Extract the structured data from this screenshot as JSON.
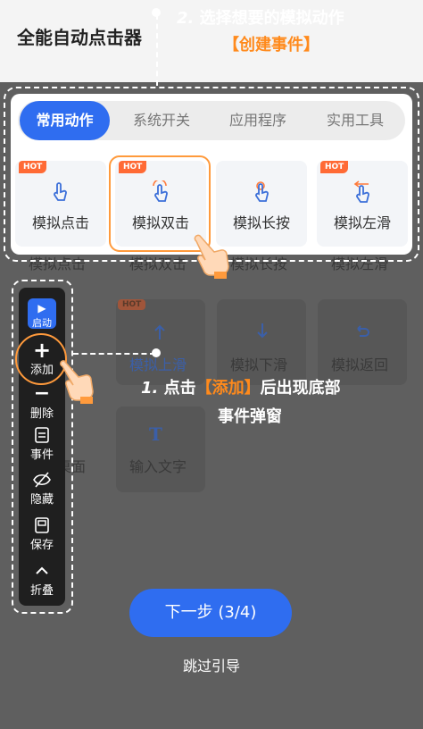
{
  "app": {
    "title": "全能自动点击器"
  },
  "guide": {
    "step2_num": "2.",
    "step2_text": "选择想要的模拟动作",
    "step2_sub": "【创建事件】",
    "step1_num": "1.",
    "step1_pre": "点击",
    "step1_highlight": "【添加】",
    "step1_post": "后出现底部",
    "step1_line2": "事件弹窗",
    "accent_color": "#ff8a1c"
  },
  "tabs": [
    {
      "label": "常用动作",
      "active": true
    },
    {
      "label": "系统开关",
      "active": false
    },
    {
      "label": "应用程序",
      "active": false
    },
    {
      "label": "实用工具",
      "active": false
    }
  ],
  "actions": [
    {
      "label": "模拟点击",
      "badge": "HOT",
      "icon": "tap-icon"
    },
    {
      "label": "模拟双击",
      "badge": "HOT",
      "icon": "double-tap-icon"
    },
    {
      "label": "模拟长按",
      "badge": "",
      "icon": "long-press-icon"
    },
    {
      "label": "模拟左滑",
      "badge": "HOT",
      "icon": "swipe-left-icon"
    }
  ],
  "background_actions": {
    "row1": [
      "模拟点击",
      "模拟双击",
      "模拟长按",
      "模拟左滑"
    ],
    "row2": [
      "模拟上滑",
      "模拟下滑",
      "模拟返回"
    ],
    "row2_badge": "HOT",
    "row3": [
      "返回桌面",
      "输入文字"
    ]
  },
  "toolbar": {
    "start": "启动",
    "add": "添加",
    "delete": "删除",
    "events": "事件",
    "hide": "隐藏",
    "save": "保存",
    "collapse": "折叠"
  },
  "footer": {
    "next_label": "下一步 (3/4)",
    "skip_label": "跳过引导"
  },
  "colors": {
    "primary": "#2f6df0",
    "hot_badge": "#ff6a35",
    "highlight": "#ff9a3c",
    "overlay": "#5f5f5f"
  }
}
